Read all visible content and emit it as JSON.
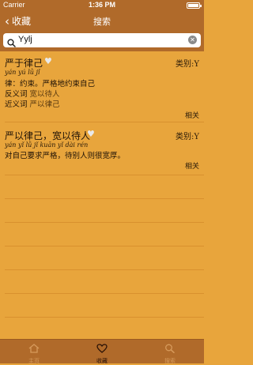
{
  "status_bar": {
    "carrier": "Carrier",
    "time": "1:36 PM"
  },
  "nav": {
    "back_label": "收藏",
    "title": "搜索"
  },
  "search": {
    "value": "Yylj"
  },
  "results": [
    {
      "word": "严于律己",
      "category": "类别:Y",
      "pinyin": "yán yú lǜ jǐ",
      "definition": "律：约束。严格地约束自己",
      "antonym_label": "反义词",
      "antonym": "宽以待人",
      "synonym_label": "近义词",
      "synonym": "严以律己",
      "related": "相关"
    },
    {
      "word": "严以律己，宽以待人",
      "category": "类别:Y",
      "pinyin": "yán yǐ lǜ jǐ kuān yǐ dài rén",
      "definition": "对自己要求严格，待别人则很宽厚。",
      "related": "相关"
    }
  ],
  "tabs": [
    {
      "label": "主页",
      "icon": "home-icon",
      "active": false
    },
    {
      "label": "收藏",
      "icon": "heart-icon",
      "active": true
    },
    {
      "label": "搜索",
      "icon": "search-icon",
      "active": false
    }
  ],
  "colors": {
    "background": "#E8A53C",
    "bar": "#B06A2A",
    "separator": "#D9912E",
    "tab_active": "#2a1206",
    "tab_inactive": "#D69A5B"
  }
}
